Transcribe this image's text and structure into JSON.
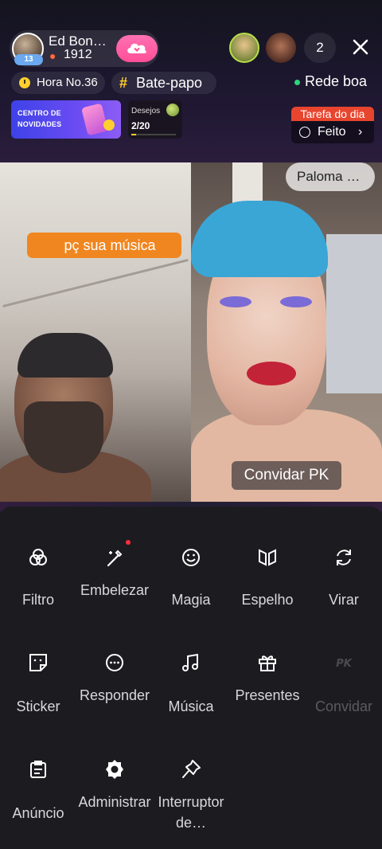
{
  "host": {
    "name": "Ed  Bon…",
    "score": "1912",
    "level": "13"
  },
  "viewers": {
    "count": "2"
  },
  "tags": {
    "hour": "Hora No.36",
    "topic": "Bate-papo",
    "network": "Rede boa"
  },
  "banner": {
    "line1": "CENTRO DE",
    "line2": "NOVIDADES"
  },
  "wishes": {
    "title": "Desejos",
    "count": "2/20",
    "progress": 0.1
  },
  "task": {
    "label": "Tarefa do dia",
    "status": "Feito"
  },
  "stream": {
    "comment": "pç sua música",
    "guest_name": "Paloma …",
    "invite_pk": "Convidar PK"
  },
  "menu": {
    "items": [
      {
        "label": "Filtro",
        "icon": "filter-icon"
      },
      {
        "label": "Embelezar",
        "icon": "beautify-wand-icon"
      },
      {
        "label": "Magia",
        "icon": "magic-face-icon"
      },
      {
        "label": "Espelho",
        "icon": "mirror-icon"
      },
      {
        "label": "Virar",
        "icon": "flip-camera-icon"
      },
      {
        "label": "Sticker",
        "icon": "sticker-icon"
      },
      {
        "label": "Responder",
        "icon": "reply-chat-icon"
      },
      {
        "label": "Música",
        "icon": "music-icon"
      },
      {
        "label": "Presentes",
        "icon": "gift-icon"
      },
      {
        "label": "Convidar",
        "icon": "pk-icon",
        "disabled": true
      },
      {
        "label": "Anúncio",
        "icon": "announcement-icon"
      },
      {
        "label": "Administrar",
        "icon": "settings-gear-icon"
      },
      {
        "label": "Interruptor de…",
        "icon": "pin-switch-icon"
      }
    ]
  },
  "colors": {
    "accent_orange": "#f0861f",
    "follow_pink": "#ff4f97",
    "status_green": "#2ed47a",
    "task_red": "#e8452e"
  }
}
